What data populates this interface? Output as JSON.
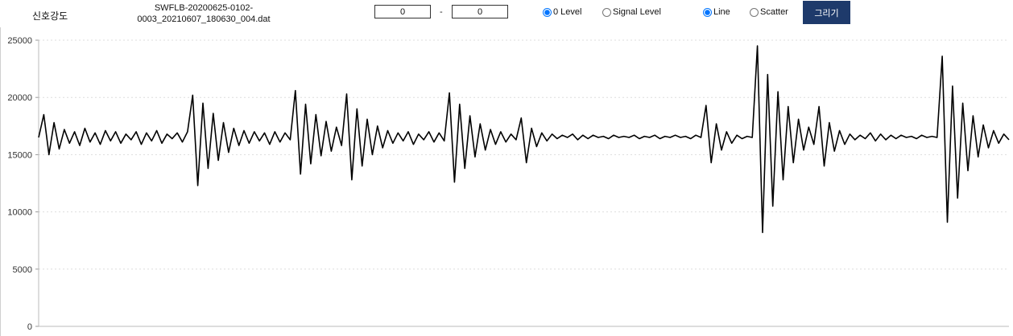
{
  "toolbar": {
    "label": "신호강도",
    "file_name_line1": "SWFLB-20200625-0102-",
    "file_name_line2": "0003_20210607_180630_004.dat",
    "range_start": "0",
    "range_separator": "-",
    "range_end": "0",
    "level_options": [
      {
        "label": "0 Level",
        "checked": true
      },
      {
        "label": "Signal Level",
        "checked": false
      }
    ],
    "type_options": [
      {
        "label": "Line",
        "checked": true
      },
      {
        "label": "Scatter",
        "checked": false
      }
    ],
    "draw_button": "그리기",
    "draw_button_color": "#1e3a6b"
  },
  "chart_data": {
    "type": "line",
    "title": "",
    "xlabel": "",
    "ylabel": "",
    "ylim": [
      0,
      25000
    ],
    "yticks": [
      "0",
      "5000",
      "10000",
      "15000",
      "20000",
      "25000"
    ],
    "grid": "horizontal dotted",
    "line_color": "#000000",
    "series": [
      {
        "values": [
          16500,
          18500,
          15000,
          17800,
          15500,
          17200,
          16000,
          17000,
          15800,
          17300,
          16100,
          16900,
          15900,
          17100,
          16200,
          17000,
          16000,
          16800,
          16300,
          17000,
          15900,
          16900,
          16200,
          17100,
          16000,
          16800,
          16400,
          16900,
          16100,
          17000,
          20200,
          12300,
          19500,
          13800,
          18600,
          14500,
          17800,
          15200,
          17300,
          15800,
          17100,
          16000,
          17000,
          16200,
          16900,
          15900,
          17000,
          16100,
          16900,
          16300,
          20600,
          13300,
          19400,
          14200,
          18500,
          14900,
          17900,
          15300,
          17400,
          15800,
          20300,
          12800,
          19000,
          14000,
          18100,
          15000,
          17500,
          15600,
          17100,
          16000,
          16900,
          16200,
          17000,
          15900,
          16800,
          16300,
          17000,
          16100,
          16900,
          16200,
          20400,
          12600,
          19400,
          13800,
          18400,
          14800,
          17700,
          15400,
          17200,
          15900,
          17000,
          16100,
          16800,
          16300,
          18200,
          14300,
          17300,
          15700,
          16900,
          16200,
          16800,
          16400,
          16700,
          16500,
          16800,
          16300,
          16700,
          16400,
          16700,
          16500,
          16600,
          16400,
          16700,
          16500,
          16600,
          16500,
          16700,
          16400,
          16600,
          16500,
          16700,
          16400,
          16600,
          16500,
          16700,
          16500,
          16600,
          16400,
          16700,
          16500,
          19300,
          14300,
          17700,
          15400,
          17000,
          16000,
          16700,
          16400,
          16600,
          16500,
          24500,
          8200,
          22000,
          10500,
          20500,
          12800,
          19200,
          14300,
          18100,
          15400,
          17400,
          15900,
          19200,
          14000,
          17800,
          15300,
          17100,
          15900,
          16800,
          16300,
          16700,
          16400,
          16900,
          16200,
          16800,
          16300,
          16700,
          16400,
          16700,
          16500,
          16600,
          16400,
          16700,
          16500,
          16600,
          16500,
          23600,
          9100,
          21000,
          11200,
          19500,
          13600,
          18400,
          14800,
          17600,
          15600,
          17100,
          16000,
          16800,
          16300
        ]
      }
    ]
  }
}
